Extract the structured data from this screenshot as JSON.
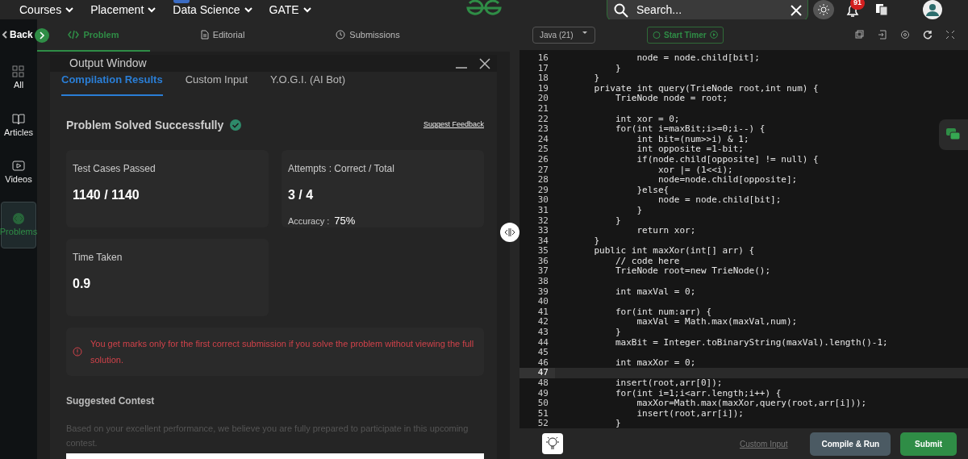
{
  "topnav": {
    "menus": [
      "Courses",
      "Placement",
      "Data Science",
      "GATE"
    ],
    "search": {
      "placeholder": "Search..."
    },
    "notifications": "91"
  },
  "sidebar": {
    "back": "Back",
    "items": [
      {
        "label": "All",
        "selected": false
      },
      {
        "label": "Articles",
        "selected": false
      },
      {
        "label": "Videos",
        "selected": false
      },
      {
        "label": "Problems",
        "selected": true
      }
    ]
  },
  "problem_tabs": [
    {
      "label": "Problem",
      "selected": true
    },
    {
      "label": "Editorial",
      "selected": false
    },
    {
      "label": "Submissions",
      "selected": false
    }
  ],
  "output_window": {
    "title": "Output Window",
    "tabs": [
      {
        "label": "Compilation Results",
        "selected": true
      },
      {
        "label": "Custom Input",
        "selected": false
      },
      {
        "label": "Y.O.G.I. (AI Bot)",
        "selected": false
      }
    ],
    "status": "Problem Solved Successfully",
    "feedback": "Suggest Feedback",
    "stats": [
      {
        "title": "Test Cases Passed",
        "value": "1140 / 1140"
      },
      {
        "title": "Attempts : Correct / Total",
        "value": "3 / 4",
        "sub_label": "Accuracy :",
        "sub_value": "75%"
      },
      {
        "title": "Time Taken",
        "value": "0.9"
      }
    ],
    "warning": "You get marks only for the first correct submission if you solve the problem without viewing the full solution.",
    "contest_title": "Suggested Contest",
    "contest_text": "Based on your excellent performance, we believe you are fully prepared to participate in this upcoming contest."
  },
  "editor": {
    "language": "Java (21)",
    "timer": "Start Timer",
    "lines": [
      {
        "number": "16",
        "text": "            node = node.child[bit];",
        "current": false
      },
      {
        "number": "17",
        "text": "        }",
        "current": false
      },
      {
        "number": "18",
        "text": "    }",
        "current": false
      },
      {
        "number": "19",
        "text": "    private int query(TrieNode root,int num) {",
        "current": false
      },
      {
        "number": "20",
        "text": "        TrieNode node = root;",
        "current": false
      },
      {
        "number": "21",
        "current": false
      },
      {
        "number": "22",
        "text": "        int xor = 0;",
        "current": false
      },
      {
        "number": "23",
        "text": "        for(int i=maxBit;i>=0;i--) {",
        "current": false
      },
      {
        "number": "24",
        "text": "            int bit=(num>>i) & 1;",
        "current": false
      },
      {
        "number": "25",
        "text": "            int opposite =1-bit;",
        "current": false
      },
      {
        "number": "26",
        "text": "            if(node.child[opposite] != null) {",
        "current": false
      },
      {
        "number": "27",
        "text": "                xor |= (1<<i);",
        "current": false
      },
      {
        "number": "28",
        "text": "                node=node.child[opposite];",
        "current": false
      },
      {
        "number": "29",
        "text": "            }else{",
        "current": false
      },
      {
        "number": "30",
        "text": "                node = node.child[bit];",
        "current": false
      },
      {
        "number": "31",
        "text": "            }",
        "current": false
      },
      {
        "number": "32",
        "text": "        }",
        "current": false
      },
      {
        "number": "33",
        "text": "            return xor;",
        "current": false
      },
      {
        "number": "34",
        "text": "    }",
        "current": false
      },
      {
        "number": "35",
        "text": "    public int maxXor(int[] arr) {",
        "current": false
      },
      {
        "number": "36",
        "text": "        // code here",
        "current": false
      },
      {
        "number": "37",
        "text": "        TrieNode root=new TrieNode();",
        "current": false
      },
      {
        "number": "38",
        "current": false
      },
      {
        "number": "39",
        "text": "        int maxVal = 0;",
        "current": false
      },
      {
        "number": "40",
        "current": false
      },
      {
        "number": "41",
        "text": "        for(int num:arr) {",
        "current": false
      },
      {
        "number": "42",
        "text": "            maxVal = Math.max(maxVal,num);",
        "current": false
      },
      {
        "number": "43",
        "text": "        }",
        "current": false
      },
      {
        "number": "44",
        "text": "        maxBit = Integer.toBinaryString(maxVal).length()-1;",
        "current": false
      },
      {
        "number": "45",
        "current": false
      },
      {
        "number": "46",
        "text": "        int maxXor = 0;",
        "current": false
      },
      {
        "number": "47",
        "current": true
      },
      {
        "number": "48",
        "text": "        insert(root,arr[0]);",
        "current": false
      },
      {
        "number": "49",
        "text": "        for(int i=1;i<arr.length;i++) {",
        "current": false
      },
      {
        "number": "50",
        "text": "            maxXor=Math.max(maxXor,query(root,arr[i]));",
        "current": false
      },
      {
        "number": "51",
        "text": "            insert(root,arr[i]);",
        "current": false
      },
      {
        "number": "52",
        "text": "        }",
        "current": false
      }
    ],
    "custom_input": "Custom Input",
    "compile": "Compile & Run",
    "submit": "Submit"
  }
}
